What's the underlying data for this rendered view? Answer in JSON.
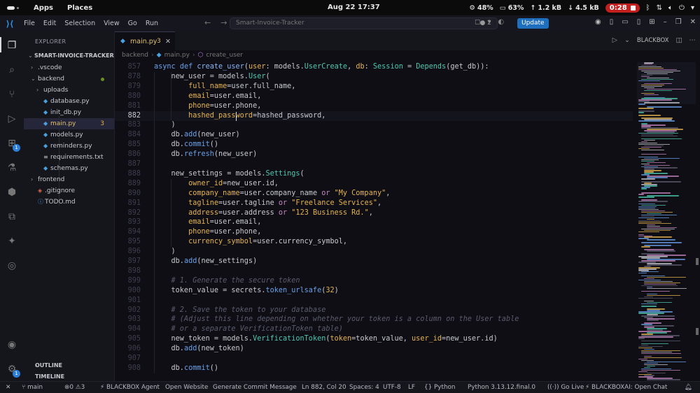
{
  "topbar": {
    "apps": "Apps",
    "places": "Places",
    "clock": "Aug 22  17:37",
    "cpu": "48%",
    "mem": "63%",
    "up": "1.2 kB",
    "down": "4.5 kB",
    "rec_time": "0:28"
  },
  "titlebar": {
    "menu": [
      "File",
      "Edit",
      "Selection",
      "View",
      "Go",
      "Run"
    ],
    "search_text": "Smart-Invoice-Tracker",
    "badge": "2",
    "update_label": "Update"
  },
  "activity": {
    "extensions_badge": "1",
    "accounts_badge": "1"
  },
  "sidebar": {
    "title": "EXPLORER",
    "root": "SMART-INVOICE-TRACKER",
    "items": [
      {
        "label": ".vscode",
        "type": "folder",
        "open": false
      },
      {
        "label": "backend",
        "type": "folder",
        "open": true
      },
      {
        "label": "uploads",
        "type": "folder",
        "open": false
      },
      {
        "label": "database.py",
        "type": "py"
      },
      {
        "label": "init_db.py",
        "type": "py"
      },
      {
        "label": "main.py",
        "type": "py",
        "count": "3"
      },
      {
        "label": "models.py",
        "type": "py"
      },
      {
        "label": "reminders.py",
        "type": "py"
      },
      {
        "label": "requirements.txt",
        "type": "txt"
      },
      {
        "label": "schemas.py",
        "type": "py"
      },
      {
        "label": "frontend",
        "type": "folder",
        "open": false
      },
      {
        "label": ".gitignore",
        "type": "git"
      },
      {
        "label": "TODO.md",
        "type": "md"
      }
    ],
    "outline": "OUTLINE",
    "timeline": "TIMELINE"
  },
  "editor": {
    "tab_name": "main.py",
    "tab_count": "3",
    "blackbox_label": "BLACKBOX",
    "breadcrumb": [
      "backend",
      "main.py",
      "create_user"
    ],
    "lines": [
      {
        "n": "857",
        "tokens": [
          [
            "kw",
            "async "
          ],
          [
            "kw",
            "def "
          ],
          [
            "fn",
            "create_user"
          ],
          [
            "op",
            "("
          ],
          [
            "param",
            "user"
          ],
          [
            "op",
            ": models."
          ],
          [
            "cls",
            "UserCreate"
          ],
          [
            "op",
            ", "
          ],
          [
            "param",
            "db"
          ],
          [
            "op",
            ": "
          ],
          [
            "cls",
            "Session"
          ],
          [
            "op",
            " = "
          ],
          [
            "cls",
            "Depends"
          ],
          [
            "op",
            "(get_db)):"
          ]
        ]
      },
      {
        "n": "878",
        "tokens": [
          [
            "op",
            "    new_user = models."
          ],
          [
            "cls",
            "User"
          ],
          [
            "op",
            "("
          ]
        ]
      },
      {
        "n": "879",
        "tokens": [
          [
            "param",
            "        full_name"
          ],
          [
            "op",
            "=user.full_name,"
          ]
        ]
      },
      {
        "n": "880",
        "tokens": [
          [
            "param",
            "        email"
          ],
          [
            "op",
            "=user.email,"
          ]
        ]
      },
      {
        "n": "881",
        "tokens": [
          [
            "param",
            "        phone"
          ],
          [
            "op",
            "=user.phone,"
          ]
        ]
      },
      {
        "n": "882",
        "tokens": [
          [
            "param",
            "        hashed_password"
          ],
          [
            "op",
            "=hashed_password,"
          ]
        ]
      },
      {
        "n": "883",
        "tokens": [
          [
            "op",
            "    )"
          ]
        ]
      },
      {
        "n": "884",
        "tokens": [
          [
            "op",
            "    db."
          ],
          [
            "call",
            "add"
          ],
          [
            "op",
            "(new_user)"
          ]
        ]
      },
      {
        "n": "885",
        "tokens": [
          [
            "op",
            "    db."
          ],
          [
            "call",
            "commit"
          ],
          [
            "op",
            "()"
          ]
        ]
      },
      {
        "n": "886",
        "tokens": [
          [
            "op",
            "    db."
          ],
          [
            "call",
            "refresh"
          ],
          [
            "op",
            "(new_user)"
          ]
        ]
      },
      {
        "n": "887",
        "tokens": []
      },
      {
        "n": "888",
        "tokens": [
          [
            "op",
            "    new_settings = models."
          ],
          [
            "cls",
            "Settings"
          ],
          [
            "op",
            "("
          ]
        ]
      },
      {
        "n": "889",
        "tokens": [
          [
            "param",
            "        owner_id"
          ],
          [
            "op",
            "=new_user.id,"
          ]
        ]
      },
      {
        "n": "890",
        "tokens": [
          [
            "param",
            "        company_name"
          ],
          [
            "op",
            "=user.company_name "
          ],
          [
            "or",
            "or "
          ],
          [
            "str",
            "\"My Company\""
          ],
          [
            "op",
            ","
          ]
        ]
      },
      {
        "n": "891",
        "tokens": [
          [
            "param",
            "        tagline"
          ],
          [
            "op",
            "=user.tagline "
          ],
          [
            "or",
            "or "
          ],
          [
            "str",
            "\"Freelance Services\""
          ],
          [
            "op",
            ","
          ]
        ]
      },
      {
        "n": "892",
        "tokens": [
          [
            "param",
            "        address"
          ],
          [
            "op",
            "=user.address "
          ],
          [
            "or",
            "or "
          ],
          [
            "str",
            "\"123 Business Rd.\""
          ],
          [
            "op",
            ","
          ]
        ]
      },
      {
        "n": "893",
        "tokens": [
          [
            "param",
            "        email"
          ],
          [
            "op",
            "=user.email,"
          ]
        ]
      },
      {
        "n": "894",
        "tokens": [
          [
            "param",
            "        phone"
          ],
          [
            "op",
            "=user.phone,"
          ]
        ]
      },
      {
        "n": "895",
        "tokens": [
          [
            "param",
            "        currency_symbol"
          ],
          [
            "op",
            "=user.currency_symbol,"
          ]
        ]
      },
      {
        "n": "896",
        "tokens": [
          [
            "op",
            "    )"
          ]
        ]
      },
      {
        "n": "897",
        "tokens": [
          [
            "op",
            "    db."
          ],
          [
            "call",
            "add"
          ],
          [
            "op",
            "(new_settings)"
          ]
        ]
      },
      {
        "n": "898",
        "tokens": []
      },
      {
        "n": "899",
        "tokens": [
          [
            "com",
            "    # 1. Generate the secure token"
          ]
        ]
      },
      {
        "n": "900",
        "tokens": [
          [
            "op",
            "    token_value = secrets."
          ],
          [
            "call",
            "token_urlsafe"
          ],
          [
            "op",
            "("
          ],
          [
            "num",
            "32"
          ],
          [
            "op",
            ")"
          ]
        ]
      },
      {
        "n": "901",
        "tokens": []
      },
      {
        "n": "902",
        "tokens": [
          [
            "com",
            "    # 2. Save the token to your database"
          ]
        ]
      },
      {
        "n": "903",
        "tokens": [
          [
            "com",
            "    # (Adjust this line depending on whether your token is a column on the User table"
          ]
        ]
      },
      {
        "n": "904",
        "tokens": [
          [
            "com",
            "    # or a separate VerificationToken table)"
          ]
        ]
      },
      {
        "n": "905",
        "tokens": [
          [
            "op",
            "    new_token = models."
          ],
          [
            "cls",
            "VerificationToken"
          ],
          [
            "op",
            "("
          ],
          [
            "param",
            "token"
          ],
          [
            "op",
            "=token_value, "
          ],
          [
            "param",
            "user_id"
          ],
          [
            "op",
            "=new_user.id)"
          ]
        ]
      },
      {
        "n": "906",
        "tokens": [
          [
            "op",
            "    db."
          ],
          [
            "call",
            "add"
          ],
          [
            "op",
            "(new_token)"
          ]
        ]
      },
      {
        "n": "907",
        "tokens": []
      },
      {
        "n": "908",
        "tokens": [
          [
            "op",
            "    db."
          ],
          [
            "call",
            "commit"
          ],
          [
            "op",
            "()"
          ]
        ]
      }
    ],
    "current_line": "882"
  },
  "statusbar": {
    "branch": "main",
    "errors": "0",
    "warnings": "3",
    "agent": "BLACKBOX Agent",
    "open_website": "Open Website",
    "gen_commit": "Generate Commit Message",
    "position": "Ln 882, Col 20",
    "spaces": "Spaces: 4",
    "encoding": "UTF-8",
    "eol": "LF",
    "language": "Python",
    "interpreter": "Python 3.13.12.final.0",
    "golive": "Go Live",
    "blackbox_chat": "BLACKBOXAI: Open Chat"
  },
  "colors": {
    "keyword": "#6aa0e8",
    "class": "#4ec9b0",
    "param": "#e6b450",
    "comment": "#5c5c70",
    "accent": "#1f6fbf",
    "record": "#c41f1f"
  }
}
